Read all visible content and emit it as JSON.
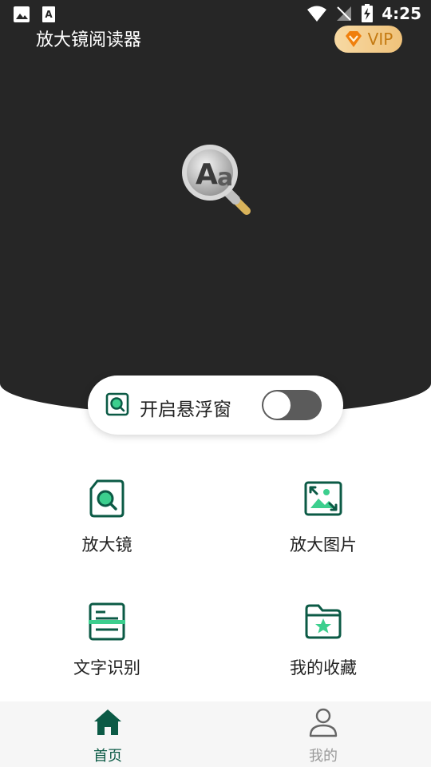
{
  "status_bar": {
    "time": "4:25",
    "left_icons": [
      "image-icon",
      "text-notification-icon"
    ],
    "right_icons": [
      "wifi-icon",
      "no-signal-icon",
      "battery-charging-icon"
    ]
  },
  "header": {
    "title": "放大镜阅读器",
    "vip_label": "VIP"
  },
  "float_window": {
    "label": "开启悬浮窗",
    "enabled": false
  },
  "features": [
    {
      "label": "放大镜",
      "icon": "magnifier-icon"
    },
    {
      "label": "放大图片",
      "icon": "enlarge-image-icon"
    },
    {
      "label": "文字识别",
      "icon": "text-recognition-icon"
    },
    {
      "label": "我的收藏",
      "icon": "favorites-folder-icon"
    }
  ],
  "tabs": [
    {
      "label": "首页",
      "icon": "home-icon",
      "active": true
    },
    {
      "label": "我的",
      "icon": "user-icon",
      "active": false
    }
  ],
  "colors": {
    "hero_background": "#262626",
    "accent_green": "#0b5a45",
    "light_green": "#3ccf8e",
    "vip_gold": "#f0c27a",
    "tab_active": "#0b5a45",
    "tab_inactive": "#9a9a9a"
  }
}
